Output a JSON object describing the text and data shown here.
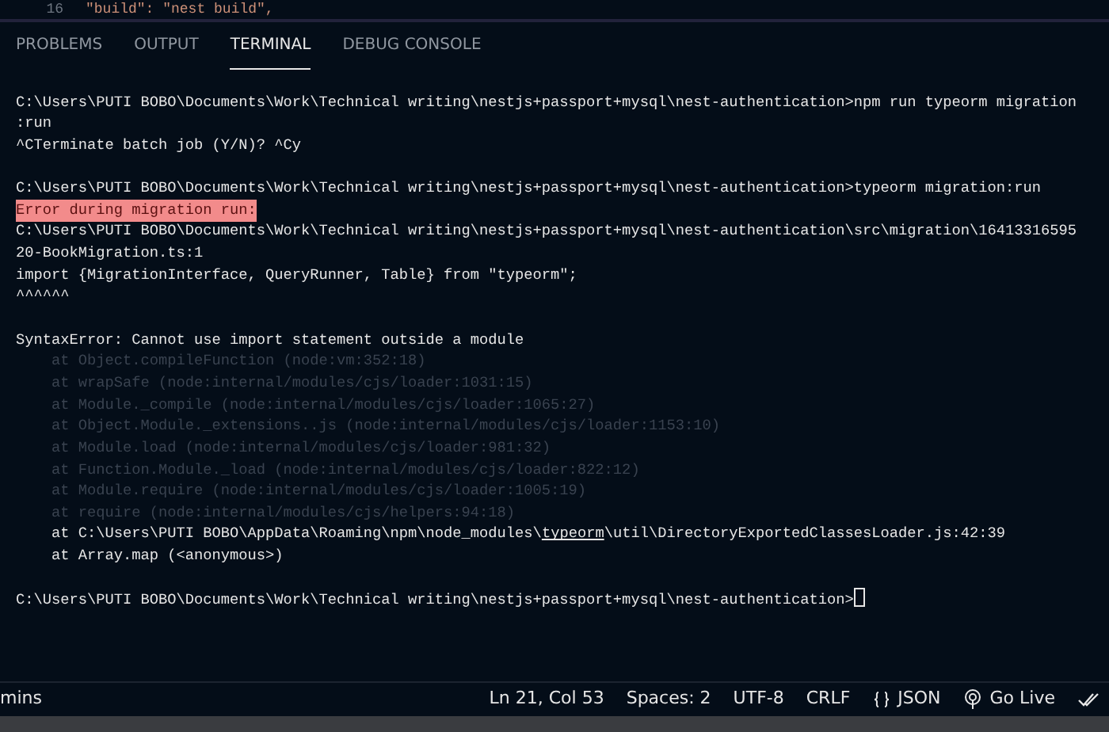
{
  "editor": {
    "line_number": "16",
    "code": "\"build\": \"nest build\","
  },
  "tabs": [
    {
      "label": "PROBLEMS",
      "selected": false
    },
    {
      "label": "OUTPUT",
      "selected": false
    },
    {
      "label": "TERMINAL",
      "selected": true
    },
    {
      "label": "DEBUG CONSOLE",
      "selected": false
    }
  ],
  "terminal_lines": [
    {
      "kind": "blank"
    },
    {
      "kind": "normal",
      "text": "C:\\Users\\PUTI BOBO\\Documents\\Work\\Technical writing\\nestjs+passport+mysql\\nest-authentication>npm run typeorm migration"
    },
    {
      "kind": "normal",
      "text": ":run"
    },
    {
      "kind": "normal",
      "text": "^CTerminate batch job (Y/N)? ^Cy"
    },
    {
      "kind": "blank"
    },
    {
      "kind": "normal",
      "text": "C:\\Users\\PUTI BOBO\\Documents\\Work\\Technical writing\\nestjs+passport+mysql\\nest-authentication>typeorm migration:run"
    },
    {
      "kind": "error",
      "text": "Error during migration run:"
    },
    {
      "kind": "normal",
      "text": "C:\\Users\\PUTI BOBO\\Documents\\Work\\Technical writing\\nestjs+passport+mysql\\nest-authentication\\src\\migration\\16413316595"
    },
    {
      "kind": "normal",
      "text": "20-BookMigration.ts:1"
    },
    {
      "kind": "normal",
      "text": "import {MigrationInterface, QueryRunner, Table} from \"typeorm\";"
    },
    {
      "kind": "normal",
      "text": "^^^^^^"
    },
    {
      "kind": "blank"
    },
    {
      "kind": "normal",
      "text": "SyntaxError: Cannot use import statement outside a module"
    },
    {
      "kind": "dim",
      "text": "    at Object.compileFunction (node:vm:352:18)"
    },
    {
      "kind": "dim",
      "text": "    at wrapSafe (node:internal/modules/cjs/loader:1031:15)"
    },
    {
      "kind": "dim",
      "text": "    at Module._compile (node:internal/modules/cjs/loader:1065:27)"
    },
    {
      "kind": "dim",
      "text": "    at Object.Module._extensions..js (node:internal/modules/cjs/loader:1153:10)"
    },
    {
      "kind": "dim",
      "text": "    at Module.load (node:internal/modules/cjs/loader:981:32)"
    },
    {
      "kind": "dim",
      "text": "    at Function.Module._load (node:internal/modules/cjs/loader:822:12)"
    },
    {
      "kind": "dim",
      "text": "    at Module.require (node:internal/modules/cjs/loader:1005:19)"
    },
    {
      "kind": "dim",
      "text": "    at require (node:internal/modules/cjs/helpers:94:18)"
    },
    {
      "kind": "segmented",
      "segments": [
        {
          "text": "    at C:\\Users\\PUTI BOBO\\AppData\\Roaming\\npm\\node_modules\\",
          "underline": false
        },
        {
          "text": "typeorm",
          "underline": true
        },
        {
          "text": "\\util\\DirectoryExportedClassesLoader.js:42:39",
          "underline": false
        }
      ]
    },
    {
      "kind": "normal",
      "text": "    at Array.map (<anonymous>)"
    },
    {
      "kind": "blank"
    },
    {
      "kind": "prompt",
      "text": "C:\\Users\\PUTI BOBO\\Documents\\Work\\Technical writing\\nestjs+passport+mysql\\nest-authentication>"
    }
  ],
  "status_bar": {
    "left": "mins",
    "items": [
      {
        "kind": "text",
        "text": "Ln 21, Col 53"
      },
      {
        "kind": "text",
        "text": "Spaces: 2"
      },
      {
        "kind": "text",
        "text": "UTF-8"
      },
      {
        "kind": "text",
        "text": "CRLF"
      },
      {
        "kind": "braces",
        "text": "JSON"
      },
      {
        "kind": "broadcast",
        "text": "Go Live"
      },
      {
        "kind": "checks"
      }
    ]
  }
}
